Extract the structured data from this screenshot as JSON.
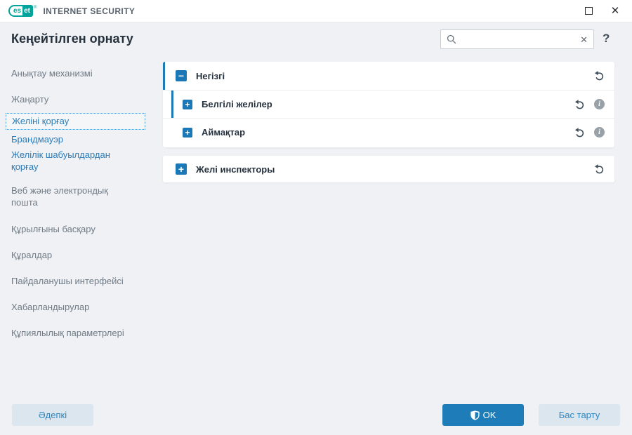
{
  "brand": {
    "logo_left": "es",
    "logo_right": "et",
    "mark": "®",
    "product": "INTERNET SECURITY"
  },
  "icons": {
    "maximize": "",
    "close": "✕",
    "clear": "✕",
    "help": "?",
    "collapse": "−",
    "expand": "+",
    "info": "i"
  },
  "header": {
    "title": "Кеңейтілген орнату"
  },
  "search": {
    "value": ""
  },
  "sidebar": {
    "items": [
      {
        "label": "Анықтау механизмі",
        "state": "normal"
      },
      {
        "label": "Жаңарту",
        "state": "normal"
      },
      {
        "label": "Желіні қорғау",
        "state": "selected"
      },
      {
        "label": "Брандмауэр",
        "state": "sub"
      },
      {
        "label": "Желілік шабуылдардан қорғау",
        "state": "sub"
      },
      {
        "label": "Веб және электрондық пошта",
        "state": "normal"
      },
      {
        "label": "Құрылғыны басқару",
        "state": "normal"
      },
      {
        "label": "Құралдар",
        "state": "normal"
      },
      {
        "label": "Пайдаланушы интерфейсі",
        "state": "normal"
      },
      {
        "label": "Хабарландырулар",
        "state": "normal"
      },
      {
        "label": "Құпиялылық параметрлері",
        "state": "normal"
      }
    ]
  },
  "content": {
    "panels": [
      {
        "rows": [
          {
            "label": "Негізгі",
            "expander": "collapse",
            "modified": true,
            "indent": 0,
            "icons": [
              "revert"
            ]
          },
          {
            "label": "Белгілі желілер",
            "expander": "expand",
            "modified": true,
            "indent": 1,
            "icons": [
              "revert",
              "info"
            ]
          },
          {
            "label": "Аймақтар",
            "expander": "expand",
            "modified": false,
            "indent": 1,
            "icons": [
              "revert",
              "info"
            ]
          }
        ]
      },
      {
        "rows": [
          {
            "label": "Желі инспекторы",
            "expander": "expand",
            "modified": false,
            "indent": 0,
            "icons": [
              "revert"
            ]
          }
        ]
      }
    ]
  },
  "footer": {
    "default_label": "Әдепкі",
    "ok_label": "OK",
    "cancel_label": "Бас тарту"
  },
  "colors": {
    "accent_blue": "#1d7ab5",
    "expander_blue": "#1a78b6",
    "ok_button": "#1e7cb8",
    "light_button": "#dce6ee",
    "brand_teal": "#00a49a",
    "background": "#eff1f4",
    "sidebar_link_blue": "#2b7cba",
    "title_text": "#26313e"
  }
}
